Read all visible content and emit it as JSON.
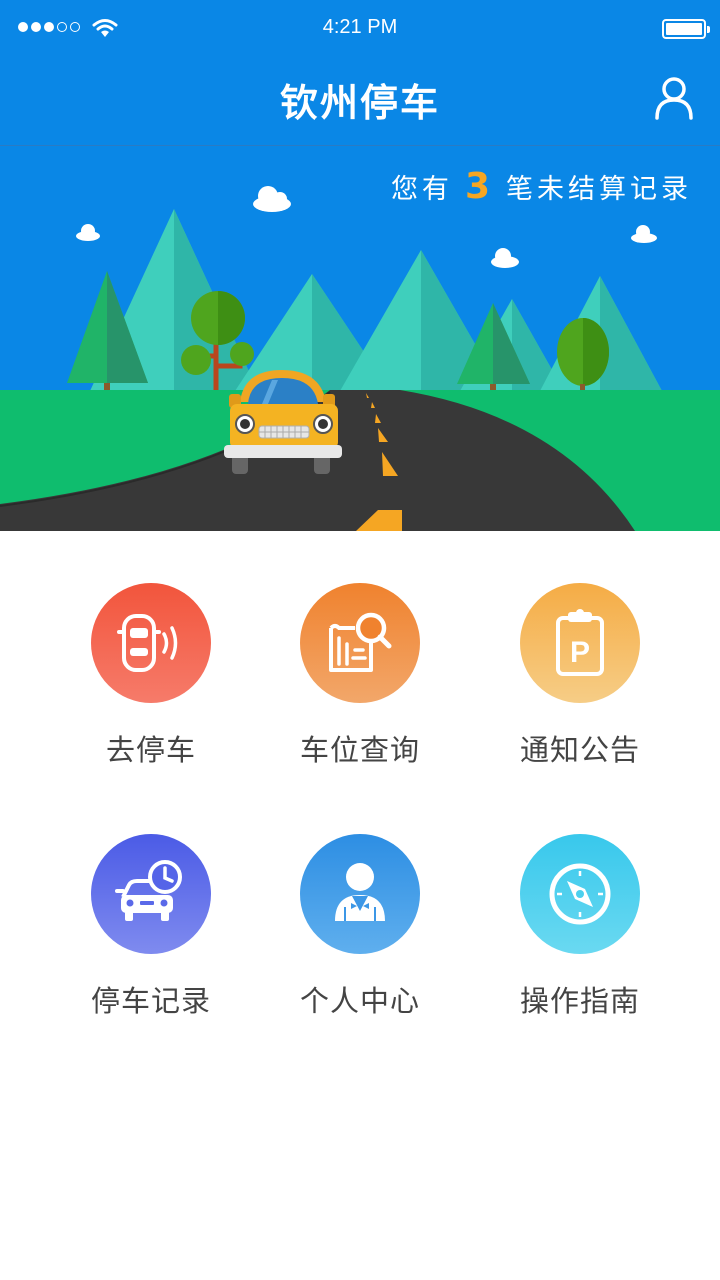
{
  "status_bar": {
    "time": "4:21 PM",
    "signal_icon": "signal-dots-icon",
    "wifi_icon": "wifi-icon",
    "battery_icon": "battery-icon"
  },
  "header": {
    "title": "钦州停车",
    "user_icon": "user-icon"
  },
  "banner": {
    "prefix": "您有",
    "count": "3",
    "suffix": "笔未结算记录"
  },
  "menu": [
    {
      "label": "去停车",
      "icon": "car-signal-icon",
      "color_top": "#f2553c",
      "color_bottom": "#f67b6a"
    },
    {
      "label": "车位查询",
      "icon": "map-search-icon",
      "color_top": "#f0822e",
      "color_bottom": "#f2a76a"
    },
    {
      "label": "通知公告",
      "icon": "parking-clipboard-icon",
      "color_top": "#f5ac45",
      "color_bottom": "#f6cd86"
    },
    {
      "label": "停车记录",
      "icon": "car-clock-icon",
      "color_top": "#4b5be6",
      "color_bottom": "#7f8bef"
    },
    {
      "label": "个人中心",
      "icon": "person-icon",
      "color_top": "#2d8ee3",
      "color_bottom": "#5fafee"
    },
    {
      "label": "操作指南",
      "icon": "compass-icon",
      "color_top": "#38c8ec",
      "color_bottom": "#6ad9f1"
    }
  ],
  "colors": {
    "primary": "#0a87e6",
    "accent": "#f5a623"
  }
}
